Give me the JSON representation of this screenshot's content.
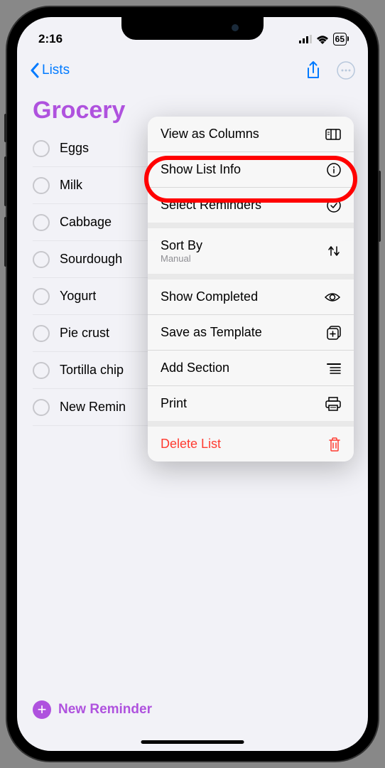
{
  "status": {
    "time": "2:16",
    "battery": "65"
  },
  "nav": {
    "back_label": "Lists"
  },
  "list": {
    "title": "Grocery",
    "items": [
      {
        "text": "Eggs"
      },
      {
        "text": "Milk"
      },
      {
        "text": "Cabbage"
      },
      {
        "text": "Sourdough"
      },
      {
        "text": "Yogurt"
      },
      {
        "text": "Pie crust"
      },
      {
        "text": "Tortilla chip"
      },
      {
        "text": "New Remin"
      }
    ]
  },
  "new_reminder": "New Reminder",
  "menu": {
    "items": [
      {
        "label": "View as Columns",
        "icon": "columns"
      },
      {
        "label": "Show List Info",
        "icon": "info"
      },
      {
        "label": "Select Reminders",
        "icon": "checkmark-circle"
      },
      {
        "label": "Sort By",
        "sublabel": "Manual",
        "icon": "sort-arrows",
        "has_submenu": true
      },
      {
        "label": "Show Completed",
        "icon": "eye"
      },
      {
        "label": "Save as Template",
        "icon": "plus-square"
      },
      {
        "label": "Add Section",
        "icon": "list-indent"
      },
      {
        "label": "Print",
        "icon": "printer"
      },
      {
        "label": "Delete List",
        "icon": "trash",
        "destructive": true
      }
    ]
  },
  "highlighted_menu_index": 1
}
